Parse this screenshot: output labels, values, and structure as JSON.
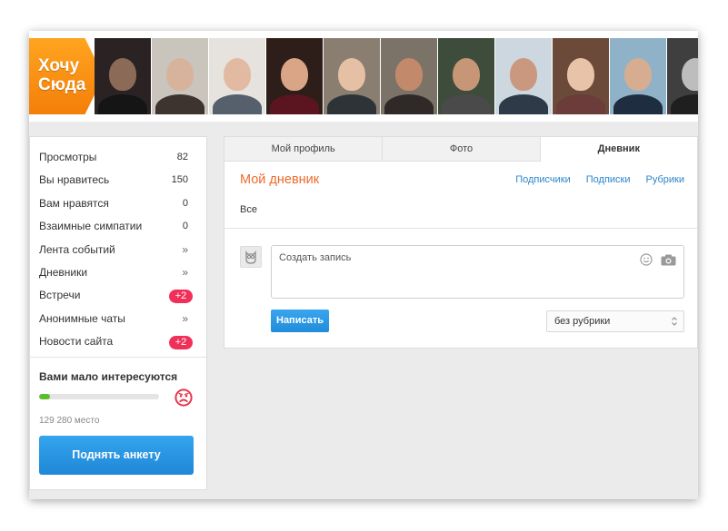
{
  "logo": {
    "line1": "Хочу",
    "line2": "Сюда"
  },
  "thumbnails": [
    {
      "bg": "#2b2323",
      "head": "#8c6a58",
      "body": "#151515"
    },
    {
      "bg": "#c9c5bd",
      "head": "#d8b39c",
      "body": "#3d3430"
    },
    {
      "bg": "#e6e2dd",
      "head": "#e2baa2",
      "body": "#55606c"
    },
    {
      "bg": "#2d1e19",
      "head": "#d9a586",
      "body": "#5a1520"
    },
    {
      "bg": "#8a7e70",
      "head": "#e5c0a4",
      "body": "#2e3338"
    },
    {
      "bg": "#7b7368",
      "head": "#c28a6a",
      "body": "#2f2a28"
    },
    {
      "bg": "#3e4d3b",
      "head": "#c79676",
      "body": "#4a4a4a"
    },
    {
      "bg": "#cdd7e0",
      "head": "#c9987e",
      "body": "#2f3a48"
    },
    {
      "bg": "#6b4a3a",
      "head": "#e9c3a9",
      "body": "#6b3c3a"
    },
    {
      "bg": "#8fb2c9",
      "head": "#d7ad92",
      "body": "#1e2e40"
    },
    {
      "bg": "#3f3f3f",
      "head": "#bdbdbd",
      "body": "#1f1f1f"
    },
    {
      "bg": "#b4a79a",
      "head": "#d3b09a",
      "body": "#4a3f36"
    }
  ],
  "stats": [
    {
      "label": "Просмотры",
      "value": "82",
      "kind": "num"
    },
    {
      "label": "Вы нравитесь",
      "value": "150",
      "kind": "num"
    },
    {
      "label": "Вам нравятся",
      "value": "0",
      "kind": "num"
    },
    {
      "label": "Взаимные симпатии",
      "value": "0",
      "kind": "num"
    },
    {
      "label": "Лента событий",
      "value": "»",
      "kind": "arrow"
    },
    {
      "label": "Дневники",
      "value": "»",
      "kind": "arrow"
    },
    {
      "label": "Встречи",
      "value": "+2",
      "kind": "pill"
    },
    {
      "label": "Анонимные чаты",
      "value": "»",
      "kind": "arrow"
    },
    {
      "label": "Новости сайта",
      "value": "+2",
      "kind": "pill"
    }
  ],
  "interest": {
    "title": "Вами мало интересуются",
    "progress_fraction": 0.09,
    "place": "129 280 место",
    "button_label": "Поднять анкету"
  },
  "tabs": [
    {
      "label": "Мой профиль"
    },
    {
      "label": "Фото"
    },
    {
      "label": "Дневник",
      "active": true
    }
  ],
  "diary": {
    "title": "Мой дневник",
    "links": [
      "Подписчики",
      "Подписки",
      "Рубрики"
    ],
    "filter_all": "Все",
    "composer_placeholder": "Создать запись",
    "write_label": "Написать",
    "rubric_selected": "без рубрики"
  },
  "colors": {
    "accent_orange": "#ee6a2c",
    "link_blue": "#2c86cc",
    "button_blue": "#218cdb",
    "badge_red": "#f1305a",
    "progress_green": "#5cbe2b"
  }
}
